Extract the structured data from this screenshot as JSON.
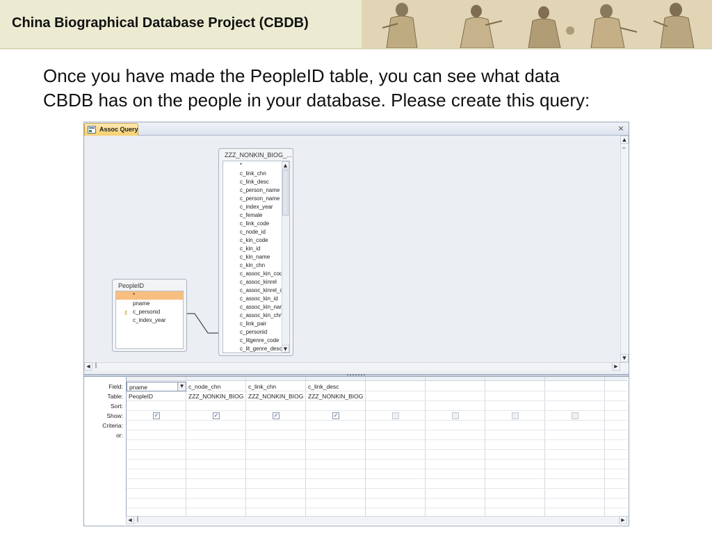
{
  "slide": {
    "title": "China Biographical Database Project (CBDB)",
    "instruction_line1": "Once you have made the PeopleID table, you can see what data",
    "instruction_line2": "CBDB has on the people in your database.  Please create this query:"
  },
  "window": {
    "tab_label": "Assoc Query",
    "close_glyph": "×"
  },
  "tables": {
    "peopleid": {
      "title": "PeopleID",
      "fields": [
        "*",
        "pname",
        "c_personid",
        "c_index_year"
      ],
      "key_field_index": 2,
      "selected_field_index": 0
    },
    "nonkin": {
      "title": "ZZZ_NONKIN_BIOG_...",
      "fields": [
        "*",
        "c_link_chn",
        "c_link_desc",
        "c_person_name",
        "c_person_name",
        "c_index_year",
        "c_female",
        "c_link_code",
        "c_node_id",
        "c_kin_code",
        "c_kin_id",
        "c_kin_name",
        "c_kin_chn",
        "c_assoc_kin_code",
        "c_assoc_kinrel",
        "c_assoc_kinrel_chn",
        "c_assoc_kin_id",
        "c_assoc_kin_name",
        "c_assoc_kin_chn",
        "c_link_pair",
        "c_personid",
        "c_litgenre_code",
        "c_lit_genre_desc"
      ]
    }
  },
  "grid": {
    "row_labels": [
      "Field:",
      "Table:",
      "Sort:",
      "Show:",
      "Criteria:",
      "or:"
    ],
    "columns": [
      {
        "field": "pname",
        "table": "PeopleID",
        "show": true
      },
      {
        "field": "c_node_chn",
        "table": "ZZZ_NONKIN_BIOG",
        "show": true
      },
      {
        "field": "c_link_chn",
        "table": "ZZZ_NONKIN_BIOG",
        "show": true
      },
      {
        "field": "c_link_desc",
        "table": "ZZZ_NONKIN_BIOG",
        "show": true
      },
      {
        "field": "",
        "table": "",
        "show": false
      },
      {
        "field": "",
        "table": "",
        "show": false
      },
      {
        "field": "",
        "table": "",
        "show": false
      },
      {
        "field": "",
        "table": "",
        "show": false
      },
      {
        "field": "",
        "table": "",
        "show": false
      }
    ]
  },
  "icons": {
    "tab": "query-icon",
    "close": "close-icon",
    "key": "key-icon",
    "combo": "chevron-down-icon",
    "scroll_up": "arrow-up-icon",
    "scroll_down": "arrow-down-icon",
    "scroll_left": "arrow-left-icon",
    "scroll_right": "arrow-right-icon"
  },
  "colors": {
    "header_band": "#ecebd2",
    "selected_field": "#f7be80",
    "tab_active": "#f7cf6b",
    "design_pane": "#ebeef3"
  }
}
